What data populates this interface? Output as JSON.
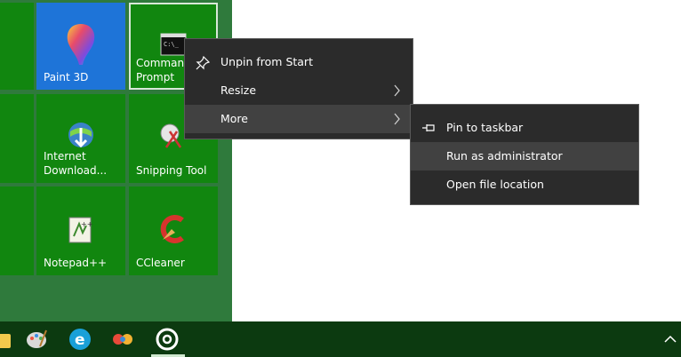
{
  "tiles": [
    {
      "label": "Paint 3D",
      "icon": "paint3d-icon"
    },
    {
      "label": "Command\nPrompt",
      "icon": "command-prompt-icon"
    },
    {
      "label": "Internet\nDownload...",
      "icon": "internet-download-manager-icon"
    },
    {
      "label": "Snipping Tool",
      "icon": "snipping-tool-icon"
    },
    {
      "label": "Notepad++",
      "icon": "notepadpp-icon"
    },
    {
      "label": "CCleaner",
      "icon": "ccleaner-icon"
    }
  ],
  "context_menu": {
    "items": [
      {
        "label": "Unpin from Start",
        "icon": "unpin-icon"
      },
      {
        "label": "Resize",
        "has_submenu": true
      },
      {
        "label": "More",
        "has_submenu": true,
        "highlighted": true
      }
    ]
  },
  "submenu": {
    "items": [
      {
        "label": "Pin to taskbar",
        "icon": "pin-icon"
      },
      {
        "label": "Run as administrator",
        "highlighted": true
      },
      {
        "label": "Open file location"
      }
    ]
  },
  "taskbar": {
    "icons": [
      "folder-icon",
      "paint-palette-icon",
      "edge-e-icon",
      "infinity-app-icon",
      "circular-app-icon",
      "chevron-up-icon"
    ]
  },
  "colors": {
    "tile_green": "#11860f",
    "tile_blue": "#1e74d8",
    "start_bg": "#2f7a3c",
    "menu_bg": "#2b2b2b",
    "taskbar_bg": "#0c3a10"
  }
}
